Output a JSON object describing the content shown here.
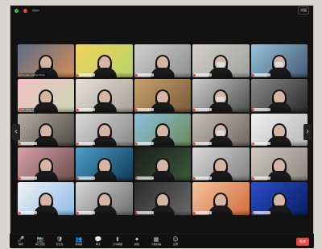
{
  "app": {
    "title_bar": {
      "left_text": "會議ID",
      "right_text": "視圖"
    }
  },
  "meeting": {
    "participants": [
      {
        "name": "Hayden Cathy Chan",
        "mic_muted": true
      },
      {
        "name": "",
        "mic_muted": true
      },
      {
        "name": "",
        "mic_muted": true
      },
      {
        "name": "",
        "mic_muted": true
      },
      {
        "name": "",
        "mic_muted": true
      },
      {
        "name": "Mo Yang Yi",
        "mic_muted": true
      },
      {
        "name": "",
        "mic_muted": true
      },
      {
        "name": "",
        "mic_muted": true
      },
      {
        "name": "",
        "mic_muted": true
      },
      {
        "name": "",
        "mic_muted": true
      },
      {
        "name": "",
        "mic_muted": true
      },
      {
        "name": "",
        "mic_muted": true
      },
      {
        "name": "",
        "mic_muted": true
      },
      {
        "name": "",
        "mic_muted": true
      },
      {
        "name": "",
        "mic_muted": true
      },
      {
        "name": "",
        "mic_muted": true
      },
      {
        "name": "",
        "mic_muted": true
      },
      {
        "name": "",
        "mic_muted": true
      },
      {
        "name": "",
        "mic_muted": true
      },
      {
        "name": "",
        "mic_muted": true
      },
      {
        "name": "",
        "mic_muted": true
      },
      {
        "name": "",
        "mic_muted": true
      },
      {
        "name": "",
        "mic_muted": true
      },
      {
        "name": "",
        "mic_muted": true
      },
      {
        "name": "",
        "mic_muted": true
      }
    ]
  },
  "toolbar": {
    "items": [
      {
        "label": "靜音",
        "icon": "mic-icon"
      },
      {
        "label": "停止視訊",
        "icon": "camera-icon"
      },
      {
        "label": "安全性",
        "icon": "shield-icon"
      },
      {
        "label": "參與者",
        "icon": "users-icon"
      },
      {
        "label": "聊天",
        "icon": "chat-icon"
      },
      {
        "label": "分享畫面",
        "icon": "share-screen-icon"
      },
      {
        "label": "錄製",
        "icon": "record-icon"
      },
      {
        "label": "分組討論",
        "icon": "breakout-icon"
      },
      {
        "label": "反應",
        "icon": "reaction-icon"
      }
    ],
    "end_label": "結束"
  }
}
